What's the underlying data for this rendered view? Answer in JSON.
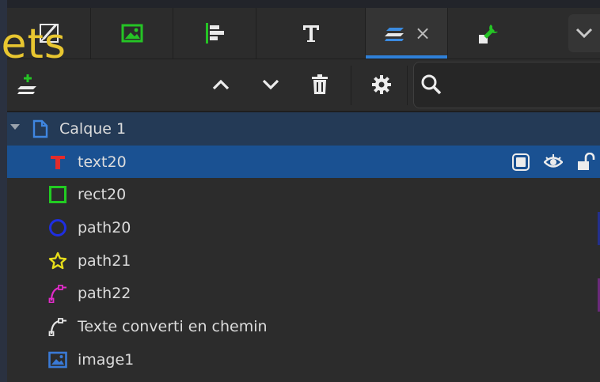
{
  "overlay_text": "jets",
  "tabs": [
    {
      "name": "tab-draw",
      "icon": "pen-ruler-icon"
    },
    {
      "name": "tab-image",
      "icon": "image-icon"
    },
    {
      "name": "tab-align",
      "icon": "align-left-icon"
    },
    {
      "name": "tab-text",
      "icon": "text-icon"
    },
    {
      "name": "tab-objects",
      "icon": "layers-icon",
      "close": "×"
    },
    {
      "name": "tab-preferences",
      "icon": "wrench-icon"
    }
  ],
  "toolbar": {
    "add_layer_icon": "add-layer-icon",
    "move_up_icon": "chevron-up-icon",
    "move_down_icon": "chevron-down-icon",
    "delete_icon": "trash-icon",
    "settings_icon": "gear-icon",
    "search": {
      "value": "",
      "placeholder": ""
    }
  },
  "layer": {
    "label": "Calque 1",
    "icon": "document-icon"
  },
  "objects": [
    {
      "label": "text20",
      "icon": "text-object-icon",
      "color": "#e22c2c",
      "selected": true
    },
    {
      "label": "rect20",
      "icon": "rectangle-icon",
      "color": "#22cc22"
    },
    {
      "label": "path20",
      "icon": "circle-icon",
      "color": "#1e2ee0"
    },
    {
      "label": "path21",
      "icon": "star-icon",
      "color": "#e6dd1a"
    },
    {
      "label": "path22",
      "icon": "bezier-path-icon",
      "color": "#e02cc8"
    },
    {
      "label": "Texte converti en chemin",
      "icon": "bezier-path-icon",
      "color": "#e6e6e6"
    },
    {
      "label": "image1",
      "icon": "image-icon",
      "color": "#3a7ad6"
    }
  ],
  "colors": {
    "accent": "#2f80d8",
    "selection": "#1a5192",
    "layer_row": "#243a56",
    "overlay_text": "#e8c630"
  }
}
